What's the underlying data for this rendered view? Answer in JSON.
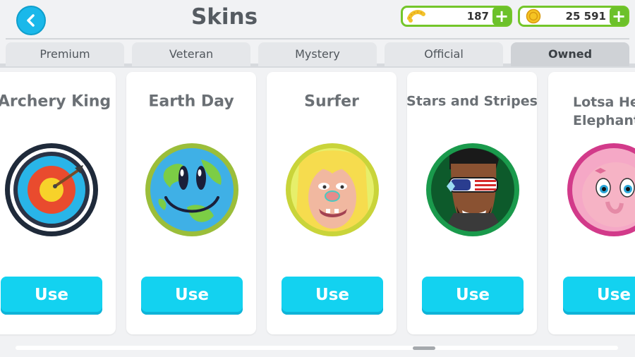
{
  "header": {
    "title": "Skins",
    "back_icon": "chevron-left-icon",
    "currencies": [
      {
        "icon": "wristband-icon",
        "value": "187",
        "add_label": "+"
      },
      {
        "icon": "gold-coin-icon",
        "value": "25 591",
        "add_label": "+"
      }
    ]
  },
  "tabs": [
    {
      "label": "Premium",
      "active": false
    },
    {
      "label": "Veteran",
      "active": false
    },
    {
      "label": "Mystery",
      "active": false
    },
    {
      "label": "Official",
      "active": false
    },
    {
      "label": "Owned",
      "active": true
    }
  ],
  "skins": [
    {
      "name": "Archery King",
      "avatar": "archery-target-avatar",
      "button": "Use"
    },
    {
      "name": "Earth Day",
      "avatar": "smiling-earth-avatar",
      "button": "Use"
    },
    {
      "name": "Surfer",
      "avatar": "blonde-surfer-avatar",
      "button": "Use"
    },
    {
      "name": "Stars and Stripes",
      "avatar": "stars-and-stripes-avatar",
      "button": "Use"
    },
    {
      "name": "Lotsa Heart Elephant",
      "name_line1": "Lotsa Hea",
      "name_line2": "Elephant",
      "avatar": "pink-elephant-avatar",
      "button": "Use"
    }
  ],
  "colors": {
    "accent": "#13d2f0",
    "back_button": "#1ab8ea",
    "currency_border": "#74c62a",
    "add_button": "#6cc12a",
    "background": "#f1f2f4"
  }
}
